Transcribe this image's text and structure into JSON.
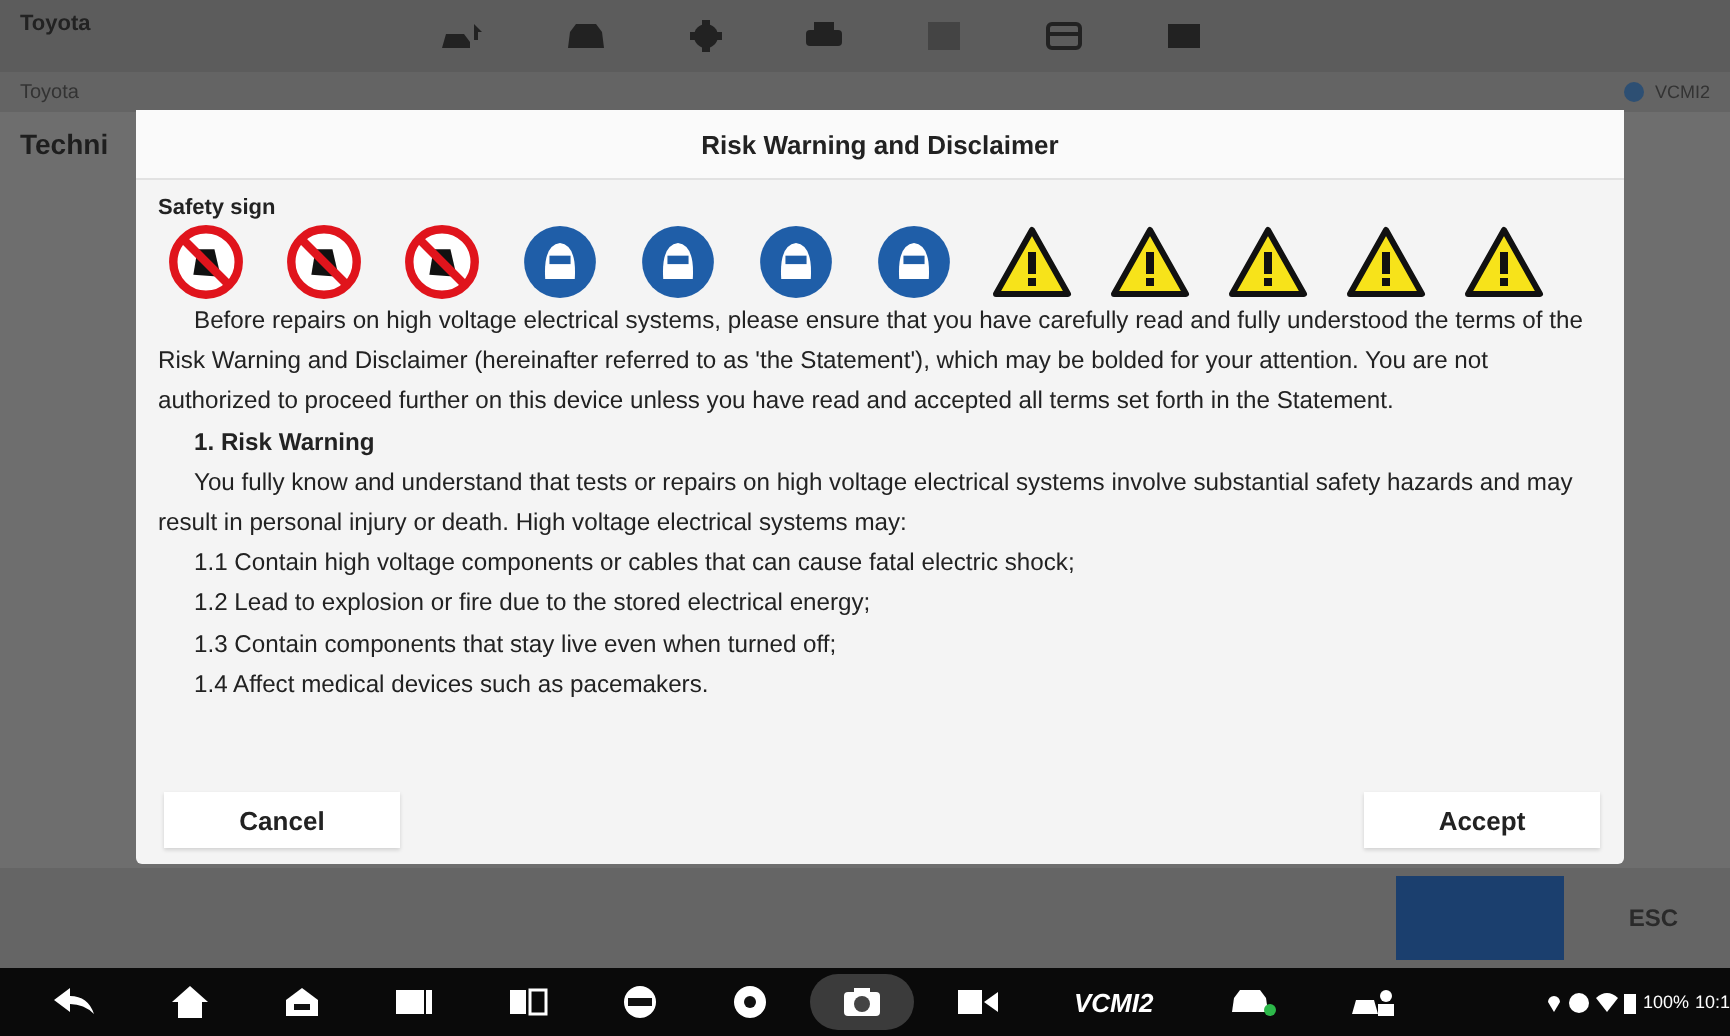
{
  "header": {
    "make": "Toyota",
    "breadcrumb": "Toyota",
    "page_title": "Techni",
    "connection": "VCMI2"
  },
  "dialog": {
    "title": "Risk Warning and Disclaimer",
    "section_label": "Safety sign",
    "signs": [
      {
        "kind": "prohibition"
      },
      {
        "kind": "prohibition"
      },
      {
        "kind": "prohibition"
      },
      {
        "kind": "mandatory"
      },
      {
        "kind": "mandatory"
      },
      {
        "kind": "mandatory"
      },
      {
        "kind": "mandatory"
      },
      {
        "kind": "warning"
      },
      {
        "kind": "warning"
      },
      {
        "kind": "warning"
      },
      {
        "kind": "warning"
      },
      {
        "kind": "warning"
      }
    ],
    "paragraphs": [
      {
        "kind": "para",
        "text": "Before repairs on high voltage electrical systems, please ensure that you have carefully read and fully understood the terms of the Risk Warning and Disclaimer (hereinafter referred to as 'the Statement'), which may be bolded for your attention. You are not authorized to proceed further on this device unless you have read and accepted all terms set forth in the Statement."
      },
      {
        "kind": "heading",
        "text": "1. Risk Warning"
      },
      {
        "kind": "para",
        "text": "You fully know and understand that tests or repairs on high voltage electrical systems involve substantial safety hazards and may result in personal injury or death. High voltage electrical systems may:"
      },
      {
        "kind": "item",
        "text": "1.1 Contain high voltage components or cables that can cause fatal electric shock;"
      },
      {
        "kind": "item",
        "text": "1.2 Lead to explosion or fire due to the stored electrical energy;"
      },
      {
        "kind": "item",
        "text": "1.3 Contain components that stay live even when turned off;"
      },
      {
        "kind": "item",
        "text": "1.4 Affect medical devices such as pacemakers."
      }
    ],
    "buttons": [
      "Cancel",
      "Accept"
    ]
  },
  "footer": {
    "esc": "ESC"
  },
  "status_bar": {
    "vcm": "VCMI2",
    "battery": "100%",
    "time": "10:1"
  }
}
